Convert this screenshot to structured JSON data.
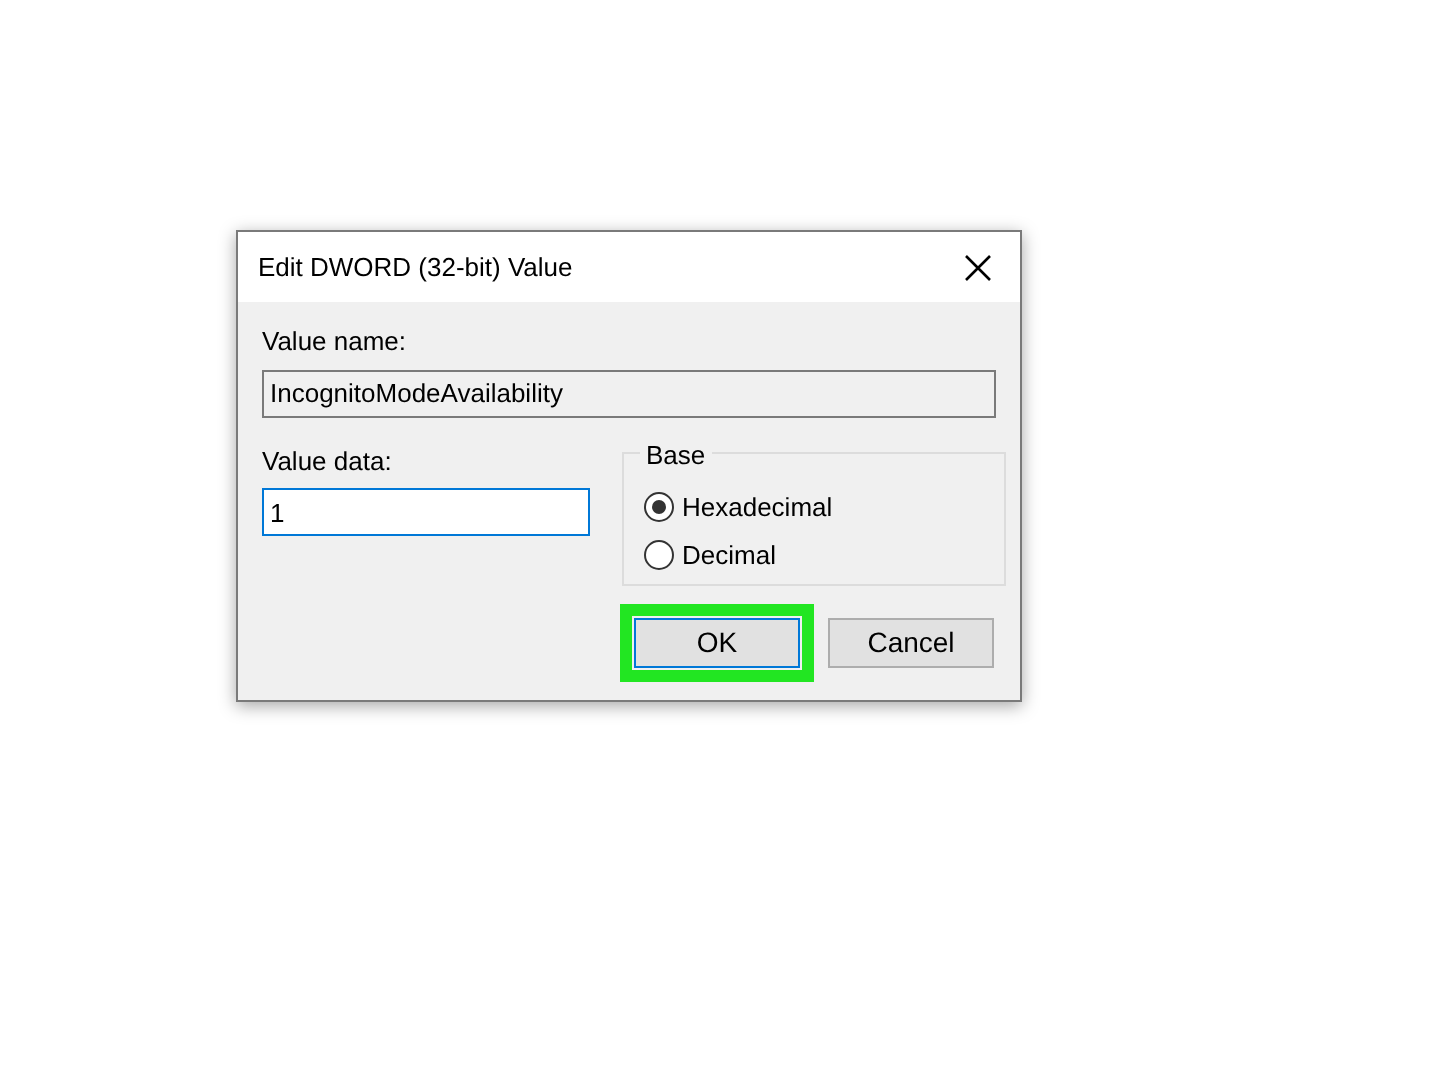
{
  "window": {
    "title": "Edit DWORD (32-bit) Value"
  },
  "value_name": {
    "label": "Value name:",
    "value": "IncognitoModeAvailability",
    "disabled": true
  },
  "value_data": {
    "label": "Value data:",
    "value": "1"
  },
  "base": {
    "label": "Base",
    "options": [
      {
        "label": "Hexadecimal",
        "selected": true
      },
      {
        "label": "Decimal",
        "selected": false
      }
    ]
  },
  "buttons": [
    {
      "label": "OK",
      "highlighted": true
    },
    {
      "label": "Cancel",
      "highlighted": false
    }
  ]
}
